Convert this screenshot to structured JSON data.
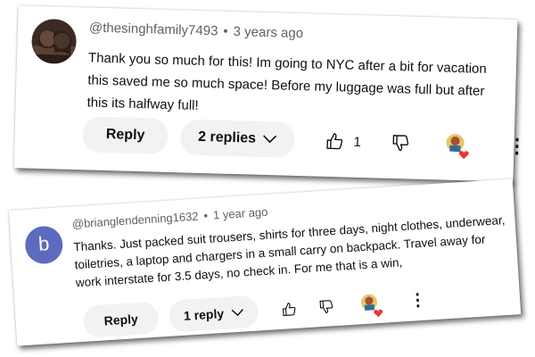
{
  "comments": [
    {
      "handle": "@thesinghfamily7493",
      "time": "3 years ago",
      "text": "Thank you so much for this! Im going to NYC after a bit for vacation this saved me so much space! Before my luggage was full but after this its halfway full!",
      "reply_label": "Reply",
      "replies_label": "2 replies",
      "like_count": "1",
      "icons": [
        "avatar-photo",
        "thumbs-up-icon",
        "thumbs-down-icon",
        "creator-heart-icon",
        "more-icon"
      ]
    },
    {
      "handle": "@brianglendenning1632",
      "time": "1 year ago",
      "avatar_letter": "b",
      "text": "Thanks.  Just packed suit trousers, shirts for three days, night clothes, underwear, toiletries, a laptop and chargers in a small carry on backpack. Travel away for work interstate for 3.5 days, no check in. For me that is a win,",
      "reply_label": "Reply",
      "replies_label": "1 reply",
      "icons": [
        "thumbs-up-icon",
        "thumbs-down-icon",
        "creator-heart-icon",
        "more-icon"
      ]
    }
  ],
  "colors": {
    "avatar_b": "#5c6bc0",
    "heart": "#e53935",
    "pill_bg": "#f2f2f2",
    "meta_text": "#606060"
  },
  "separator": "•",
  "chevron": "⌵",
  "more_glyph": "⋮"
}
